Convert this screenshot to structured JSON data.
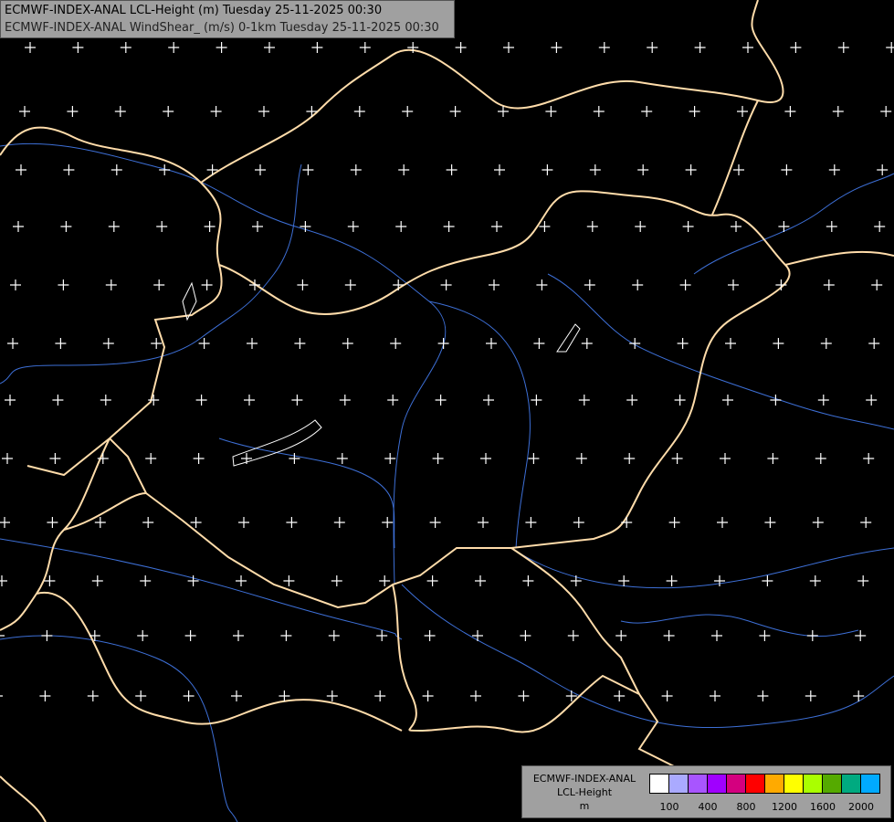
{
  "title": {
    "line1": "ECMWF-INDEX-ANAL LCL-Height (m) Tuesday 25-11-2025 00:30",
    "line2": "ECMWF-INDEX-ANAL WindShear_ (m/s) 0-1km Tuesday 25-11-2025 00:30"
  },
  "legend": {
    "source": "ECMWF-INDEX-ANAL",
    "parameter": "LCL-Height",
    "unit": "m",
    "colors": [
      "#ffffff",
      "#aaaaff",
      "#a855ff",
      "#a000ff",
      "#d4007f",
      "#ff0000",
      "#ffaa00",
      "#ffff00",
      "#aaff00",
      "#55aa00",
      "#00aa80",
      "#00aaff"
    ],
    "ticks": [
      "100",
      "400",
      "800",
      "1200",
      "1600",
      "2000"
    ]
  },
  "map": {
    "border_color": "#ffdcaa",
    "river_color": "#3d6fd6",
    "marker_color": "#ffffff",
    "marker_symbol": "plus"
  }
}
